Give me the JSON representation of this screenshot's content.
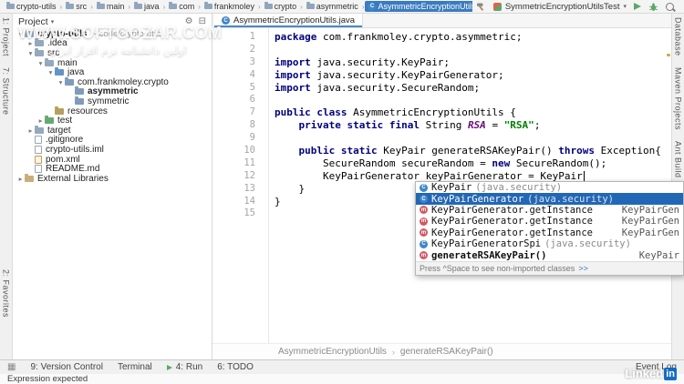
{
  "navbar": {
    "separator": "›",
    "breadcrumbs": [
      {
        "label": "crypto-utils",
        "icon": "folder"
      },
      {
        "label": "src",
        "icon": "folder"
      },
      {
        "label": "main",
        "icon": "folder"
      },
      {
        "label": "java",
        "icon": "folder"
      },
      {
        "label": "com",
        "icon": "folder"
      },
      {
        "label": "frankmoley",
        "icon": "folder"
      },
      {
        "label": "crypto",
        "icon": "folder"
      },
      {
        "label": "asymmetric",
        "icon": "folder"
      },
      {
        "label": "AsymmetricEncryptionUtils",
        "icon": "class",
        "selected": true
      }
    ],
    "run_config": "SymmetricEncryptionUtilsTest"
  },
  "tab": {
    "label": "AsymmetricEncryptionUtils.java"
  },
  "left_stripe": [
    {
      "label": "1: Project"
    },
    {
      "label": "7: Structure"
    },
    {
      "label": "2: Favorites",
      "bottom": true
    }
  ],
  "right_stripe": [
    {
      "label": "Database"
    },
    {
      "label": "Maven Projects"
    },
    {
      "label": "Ant Build"
    }
  ],
  "project_panel": {
    "title": "Project",
    "tree": [
      {
        "label": "crypto-utils",
        "note": "~/code/crypto-utils",
        "depth": 0,
        "icon": "folder",
        "arrow": "down",
        "bold": true
      },
      {
        "label": ".idea",
        "depth": 1,
        "icon": "folder",
        "arrow": "right"
      },
      {
        "label": "src",
        "depth": 1,
        "icon": "folder",
        "arrow": "down"
      },
      {
        "label": "main",
        "depth": 2,
        "icon": "folder",
        "arrow": "down"
      },
      {
        "label": "java",
        "depth": 3,
        "icon": "folder-src",
        "arrow": "down"
      },
      {
        "label": "com.frankmoley.crypto",
        "depth": 4,
        "icon": "package",
        "arrow": "down"
      },
      {
        "label": "asymmetric",
        "depth": 5,
        "icon": "package",
        "arrow": "",
        "bold": true
      },
      {
        "label": "symmetric",
        "depth": 5,
        "icon": "package",
        "arrow": ""
      },
      {
        "label": "resources",
        "depth": 3,
        "icon": "folder-res",
        "arrow": ""
      },
      {
        "label": "test",
        "depth": 2,
        "icon": "folder-test",
        "arrow": "right"
      },
      {
        "label": "target",
        "depth": 1,
        "icon": "folder",
        "arrow": "right"
      },
      {
        "label": ".gitignore",
        "depth": 1,
        "icon": "file",
        "arrow": ""
      },
      {
        "label": "crypto-utils.iml",
        "depth": 1,
        "icon": "file",
        "arrow": ""
      },
      {
        "label": "pom.xml",
        "depth": 1,
        "icon": "file-xml",
        "arrow": ""
      },
      {
        "label": "README.md",
        "depth": 1,
        "icon": "file",
        "arrow": ""
      },
      {
        "label": "External Libraries",
        "depth": 0,
        "icon": "lib",
        "arrow": "right"
      }
    ]
  },
  "editor": {
    "caret_line": 12,
    "lines": [
      [
        {
          "t": "package ",
          "s": "kw"
        },
        {
          "t": "com.frankmoley.crypto.asymmetric;",
          "s": "p"
        }
      ],
      [],
      [
        {
          "t": "import ",
          "s": "kw"
        },
        {
          "t": "java.security.KeyPair;",
          "s": "p"
        }
      ],
      [
        {
          "t": "import ",
          "s": "kw"
        },
        {
          "t": "java.security.KeyPairGenerator;",
          "s": "p"
        }
      ],
      [
        {
          "t": "import ",
          "s": "kw"
        },
        {
          "t": "java.security.SecureRandom;",
          "s": "p"
        }
      ],
      [],
      [
        {
          "t": "public class ",
          "s": "kw"
        },
        {
          "t": "AsymmetricEncryptionUtils {",
          "s": "p"
        }
      ],
      [
        {
          "t": "    ",
          "s": "p"
        },
        {
          "t": "private static final ",
          "s": "kw"
        },
        {
          "t": "String ",
          "s": "p"
        },
        {
          "t": "RSA ",
          "s": "fld"
        },
        {
          "t": "= ",
          "s": "p"
        },
        {
          "t": "\"RSA\"",
          "s": "str"
        },
        {
          "t": ";",
          "s": "p"
        }
      ],
      [],
      [
        {
          "t": "    ",
          "s": "p"
        },
        {
          "t": "public static ",
          "s": "kw"
        },
        {
          "t": "KeyPair generateRSAKeyPair() ",
          "s": "p"
        },
        {
          "t": "throws ",
          "s": "kw"
        },
        {
          "t": "Exception{",
          "s": "p"
        }
      ],
      [
        {
          "t": "        SecureRandom secureRandom = ",
          "s": "p"
        },
        {
          "t": "new ",
          "s": "kw"
        },
        {
          "t": "SecureRandom();",
          "s": "p"
        }
      ],
      [
        {
          "t": "        KeyPairGenerator keyPairGenerator = KeyPair",
          "s": "p"
        }
      ],
      [
        {
          "t": "    }",
          "s": "p"
        }
      ],
      [
        {
          "t": "}",
          "s": "p"
        }
      ],
      []
    ]
  },
  "completion": {
    "items": [
      {
        "icon": "class",
        "label": "KeyPair",
        "detail": "(java.security)"
      },
      {
        "icon": "class",
        "label": "KeyPairGenerator",
        "detail": "(java.security)",
        "selected": true
      },
      {
        "icon": "method",
        "label": "KeyPairGenerator.getInstance",
        "right": "KeyPairGen"
      },
      {
        "icon": "method",
        "label": "KeyPairGenerator.getInstance",
        "right": "KeyPairGen"
      },
      {
        "icon": "method",
        "label": "KeyPairGenerator.getInstance",
        "right": "KeyPairGen"
      },
      {
        "icon": "class",
        "label": "KeyPairGeneratorSpi",
        "detail": "(java.security)"
      },
      {
        "icon": "method",
        "label": "generateRSAKeyPair()",
        "right": "KeyPair",
        "bold": true
      }
    ],
    "footer_text": "Press ^Space to see non-imported classes",
    "footer_link": ">>"
  },
  "bottom_breadcrumbs": [
    "AsymmetricEncryptionUtils",
    "generateRSAKeyPair()"
  ],
  "bottom_separator": "›",
  "status_stripe": {
    "buttons": [
      {
        "label": "9: Version Control"
      },
      {
        "label": "Terminal"
      },
      {
        "label": "4: Run",
        "icon": "run"
      },
      {
        "label": "6: TODO"
      }
    ],
    "right": "Event Log"
  },
  "statusbar_message": "Expression expected",
  "watermarks": {
    "site_line1": "WWW.SOFTGOZAR.COM",
    "site_line2": "اولین دانشنامه نرم افزار ایران",
    "linkedin_text": "Linked",
    "linkedin_badge": "in"
  },
  "colors": {
    "selection_blue": "#2267b5",
    "breadcrumb_blue": "#3a7bbf",
    "run_green": "#5ba767",
    "error_red": "#d64f4f",
    "keyword_navy": "#000080",
    "string_green": "#008000",
    "field_purple": "#660e7a",
    "linkedin_blue": "#0a66c2"
  }
}
